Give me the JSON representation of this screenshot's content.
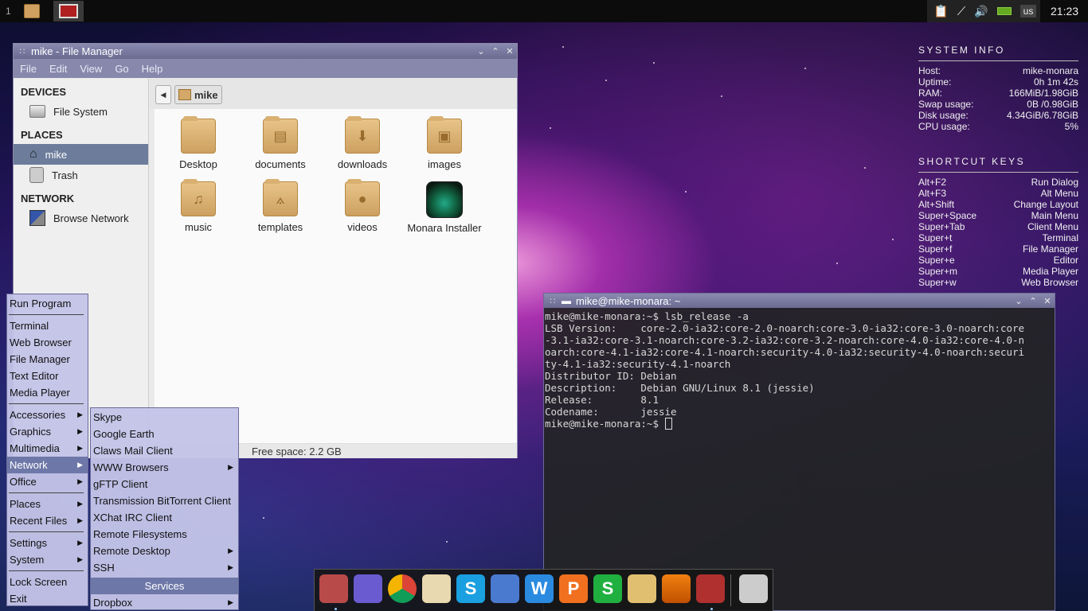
{
  "top_panel": {
    "workspace": "1",
    "keyboard_layout": "us",
    "clock": "21:23"
  },
  "system_info": {
    "title": "SYSTEM INFO",
    "rows": [
      {
        "label": "Host:",
        "value": "mike-monara"
      },
      {
        "label": "Uptime:",
        "value": "0h 1m 42s"
      },
      {
        "label": "RAM:",
        "value": "166MiB/1.98GiB"
      },
      {
        "label": "Swap usage:",
        "value": "0B  /0.98GiB"
      },
      {
        "label": "Disk usage:",
        "value": "4.34GiB/6.78GiB"
      },
      {
        "label": "CPU usage:",
        "value": "5%"
      }
    ]
  },
  "shortcut_keys": {
    "title": "SHORTCUT KEYS",
    "rows": [
      {
        "key": "Alt+F2",
        "action": "Run Dialog"
      },
      {
        "key": "Alt+F3",
        "action": "Alt Menu"
      },
      {
        "key": "Alt+Shift",
        "action": "Change Layout"
      },
      {
        "key": "Super+Space",
        "action": "Main Menu"
      },
      {
        "key": "Super+Tab",
        "action": "Client Menu"
      },
      {
        "key": "Super+t",
        "action": "Terminal"
      },
      {
        "key": "Super+f",
        "action": "File Manager"
      },
      {
        "key": "Super+e",
        "action": "Editor"
      },
      {
        "key": "Super+m",
        "action": "Media Player"
      },
      {
        "key": "Super+w",
        "action": "Web Browser"
      }
    ]
  },
  "file_manager": {
    "title": "mike - File Manager",
    "menu": [
      "File",
      "Edit",
      "View",
      "Go",
      "Help"
    ],
    "sidebar": {
      "devices_header": "DEVICES",
      "file_system": "File System",
      "places_header": "PLACES",
      "home": "mike",
      "trash": "Trash",
      "network_header": "NETWORK",
      "browse_network": "Browse Network"
    },
    "path": "mike",
    "items": [
      {
        "label": "Desktop",
        "glyph": ""
      },
      {
        "label": "documents",
        "glyph": "▤"
      },
      {
        "label": "downloads",
        "glyph": "⬇"
      },
      {
        "label": "images",
        "glyph": "▣"
      },
      {
        "label": "music",
        "glyph": "♫"
      },
      {
        "label": "templates",
        "glyph": "⟑"
      },
      {
        "label": "videos",
        "glyph": "●"
      },
      {
        "label": "Monara Installer",
        "glyph": ""
      }
    ],
    "status": "Free space: 2.2 GB"
  },
  "terminal": {
    "title": "mike@mike-monara: ~",
    "lines": [
      "mike@mike-monara:~$ lsb_release -a",
      "LSB Version:    core-2.0-ia32:core-2.0-noarch:core-3.0-ia32:core-3.0-noarch:core",
      "-3.1-ia32:core-3.1-noarch:core-3.2-ia32:core-3.2-noarch:core-4.0-ia32:core-4.0-n",
      "oarch:core-4.1-ia32:core-4.1-noarch:security-4.0-ia32:security-4.0-noarch:securi",
      "ty-4.1-ia32:security-4.1-noarch",
      "Distributor ID: Debian",
      "Description:    Debian GNU/Linux 8.1 (jessie)",
      "Release:        8.1",
      "Codename:       jessie"
    ],
    "prompt": "mike@mike-monara:~$ "
  },
  "main_menu": {
    "run_program": "Run Program",
    "apps": [
      "Terminal",
      "Web Browser",
      "File Manager",
      "Text Editor",
      "Media Player"
    ],
    "categories": [
      "Accessories",
      "Graphics",
      "Multimedia",
      "Network",
      "Office"
    ],
    "places": [
      "Places",
      "Recent Files"
    ],
    "system": [
      "Settings",
      "System"
    ],
    "session": [
      "Lock Screen",
      "Exit"
    ]
  },
  "network_menu": {
    "items": [
      "Skype",
      "Google Earth",
      "Claws Mail Client",
      "WWW Browsers",
      "gFTP Client",
      "Transmission BitTorrent Client",
      "XChat IRC Client",
      "Remote Filesystems",
      "Remote Desktop",
      "SSH"
    ],
    "services_header": "Services",
    "dropbox": "Dropbox"
  },
  "dock": {
    "colors": [
      "#b84a4a",
      "#6a5bd0",
      "#ffffff",
      "#e9d9b0",
      "#1aa0e0",
      "#4a7ad0",
      "#2a8ae0",
      "#f07020",
      "#20b040",
      "#e0c070",
      "#f08010",
      "#b03030",
      "#cccccc"
    ],
    "glyphs": [
      "",
      "",
      "",
      "",
      "S",
      "",
      "W",
      "P",
      "S",
      "",
      "",
      "",
      ""
    ]
  }
}
